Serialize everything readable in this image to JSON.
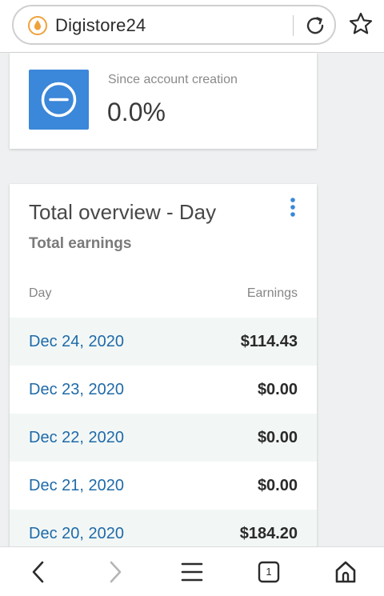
{
  "browser": {
    "url_text": "Digistore24",
    "icons": {
      "site": "digistore-drop-icon",
      "reload": "reload-icon",
      "bookmark": "star-icon"
    }
  },
  "stat_card": {
    "label": "Since account creation",
    "value": "0.0%",
    "badge_color": "#3b87d9",
    "badge_icon": "minus-circle-icon"
  },
  "overview": {
    "title": "Total overview - Day",
    "subtitle": "Total earnings",
    "columns": {
      "day": "Day",
      "earnings": "Earnings"
    },
    "rows": [
      {
        "day": "Dec 24, 2020",
        "earnings": "$114.43"
      },
      {
        "day": "Dec 23, 2020",
        "earnings": "$0.00"
      },
      {
        "day": "Dec 22, 2020",
        "earnings": "$0.00"
      },
      {
        "day": "Dec 21, 2020",
        "earnings": "$0.00"
      },
      {
        "day": "Dec 20, 2020",
        "earnings": "$184.20"
      }
    ]
  },
  "bottom_nav": {
    "tab_count": "1",
    "items": [
      "back-icon",
      "forward-icon",
      "menu-icon",
      "tabs-icon",
      "home-icon"
    ]
  },
  "colors": {
    "link": "#1f6aa8",
    "accent": "#3b87d9",
    "row_alt": "#f2f7f6",
    "site_icon": "#f0a23a"
  }
}
